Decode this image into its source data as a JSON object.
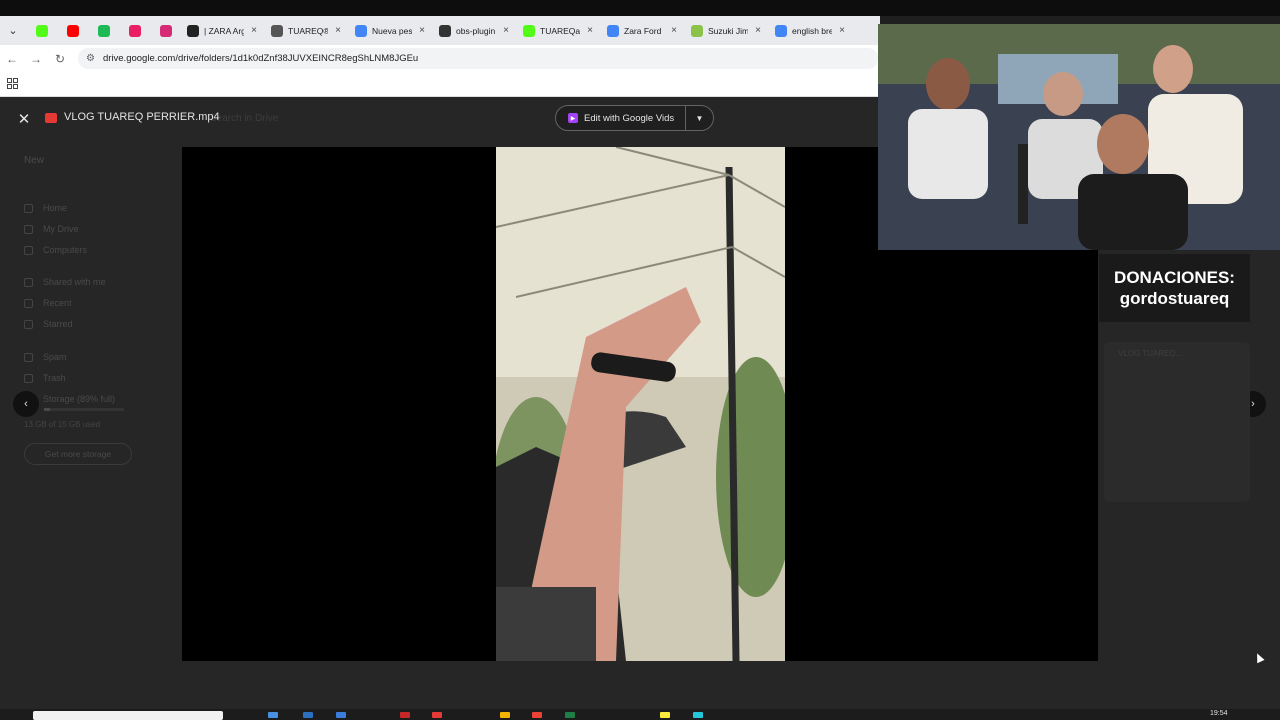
{
  "browser": {
    "tabs": [
      {
        "title": "",
        "icon": "kick-icon",
        "color": "#53fc18"
      },
      {
        "title": "",
        "icon": "youtube-icon",
        "color": "#ff0000"
      },
      {
        "title": "",
        "icon": "spotify-icon",
        "color": "#1db954"
      },
      {
        "title": "",
        "icon": "p-app-icon",
        "color": "#e91e63"
      },
      {
        "title": "",
        "icon": "instagram-icon",
        "color": "#d62976"
      },
      {
        "title": "| ZARA Arg",
        "icon": "zara-icon",
        "color": "#222222"
      },
      {
        "title": "TUAREQ®",
        "icon": "tuareq-icon",
        "color": "#555555"
      },
      {
        "title": "Nueva pes",
        "icon": "chrome-icon",
        "color": "#4285f4"
      },
      {
        "title": "obs-plugin",
        "icon": "github-icon",
        "color": "#333333"
      },
      {
        "title": "TUAREQar",
        "icon": "kick-icon",
        "color": "#53fc18"
      },
      {
        "title": "Zara Ford",
        "icon": "google-icon",
        "color": "#4285f4"
      },
      {
        "title": "Suzuki Jim",
        "icon": "suzuki-icon",
        "color": "#8bc34a"
      },
      {
        "title": "english bre",
        "icon": "google-icon",
        "color": "#4285f4"
      }
    ],
    "url": "drive.google.com/drive/folders/1d1k0dZnf38JUVXEINCR8egShLNM8JGEu"
  },
  "drive_sidebar": {
    "new_label": "New",
    "items": [
      "Home",
      "My Drive",
      "Computers",
      "Shared with me",
      "Recent",
      "Starred",
      "Spam",
      "Trash",
      "Storage (89% full)"
    ],
    "storage_text": "13.GB of 15 GB used",
    "get_storage": "Get more storage",
    "search_placeholder": "Search in Drive"
  },
  "viewer": {
    "file_name": "VLOG TUAREQ PERRIER.mp4",
    "edit_button": "Edit with Google Vids"
  },
  "overlay": {
    "donation_line1": "DONACIONES:",
    "donation_line2": "gordostuareq",
    "ghost_file": "VLOG TUAREQ..."
  },
  "taskbar": {
    "clock": "19:54"
  }
}
